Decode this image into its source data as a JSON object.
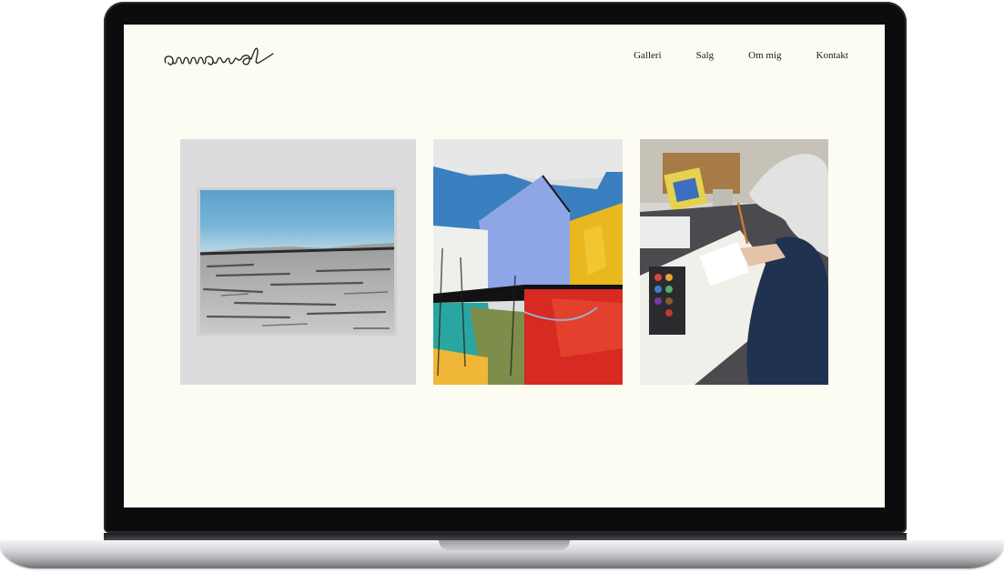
{
  "site": {
    "logo_text": "annarud"
  },
  "nav": {
    "items": [
      {
        "label": "Galleri"
      },
      {
        "label": "Salg"
      },
      {
        "label": "Om mig"
      },
      {
        "label": "Kontakt"
      }
    ]
  },
  "gallery": {
    "tiles": [
      {
        "subject": "watercolor landscape with blue sky and grey fields"
      },
      {
        "subject": "abstract painting of a house in blue, yellow and red"
      },
      {
        "subject": "artist painting with watercolors at a desk"
      }
    ]
  },
  "colors": {
    "page_background": "#fdfcf3",
    "text": "#1a1a1a",
    "bezel": "#0c0c0e"
  }
}
